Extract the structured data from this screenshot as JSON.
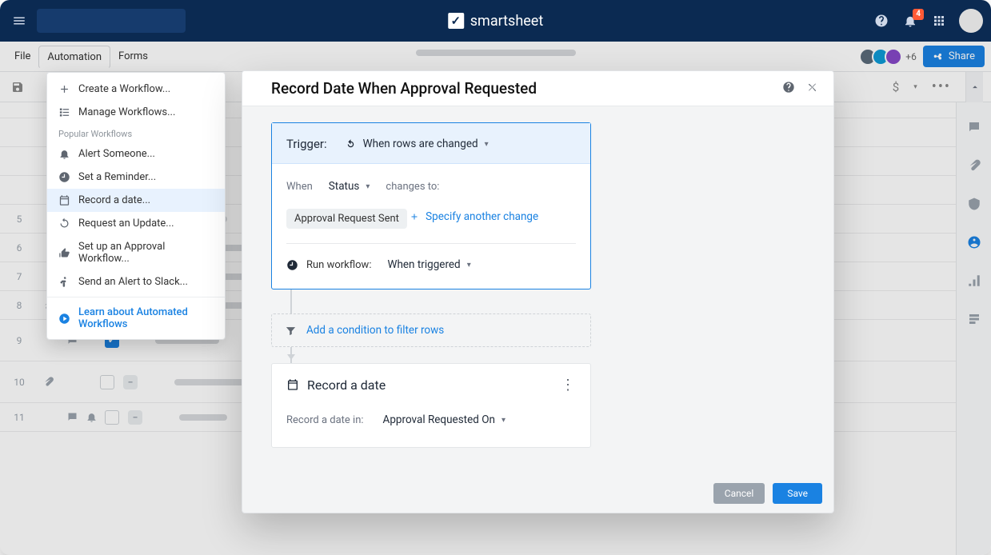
{
  "brand": "smartsheet",
  "notifications_count": "4",
  "menubar": {
    "file": "File",
    "automation": "Automation",
    "forms": "Forms",
    "share": "Share",
    "plus_count": "+6"
  },
  "avatars_row": [
    "#5a6a7a",
    "#0e9ad6",
    "#8648c8"
  ],
  "dropdown": {
    "create_workflow": "Create a Workflow...",
    "manage_workflows": "Manage Workflows...",
    "heading": "Popular Workflows",
    "alert": "Alert Someone...",
    "reminder": "Set a Reminder...",
    "record_date": "Record a date...",
    "request_update": "Request an Update...",
    "approval": "Set up an Approval Workflow...",
    "slack": "Send an Alert to Slack...",
    "learn": "Learn about Automated Workflows"
  },
  "modal": {
    "title": "Record Date When Approval Requested",
    "trigger_label": "Trigger:",
    "trigger_value": "When rows are changed",
    "when": "When",
    "field": "Status",
    "changes_to": "changes to:",
    "pill": "Approval Request Sent",
    "specify": "Specify another change",
    "run_label": "Run workflow:",
    "run_value": "When triggered",
    "condition": "Add a condition to filter rows",
    "action_title": "Record a date",
    "action_field_label": "Record a date in:",
    "action_field_value": "Approval Requested On",
    "cancel": "Cancel",
    "save": "Save"
  },
  "rows": [
    "5",
    "6",
    "7",
    "8",
    "9",
    "10",
    "11"
  ]
}
